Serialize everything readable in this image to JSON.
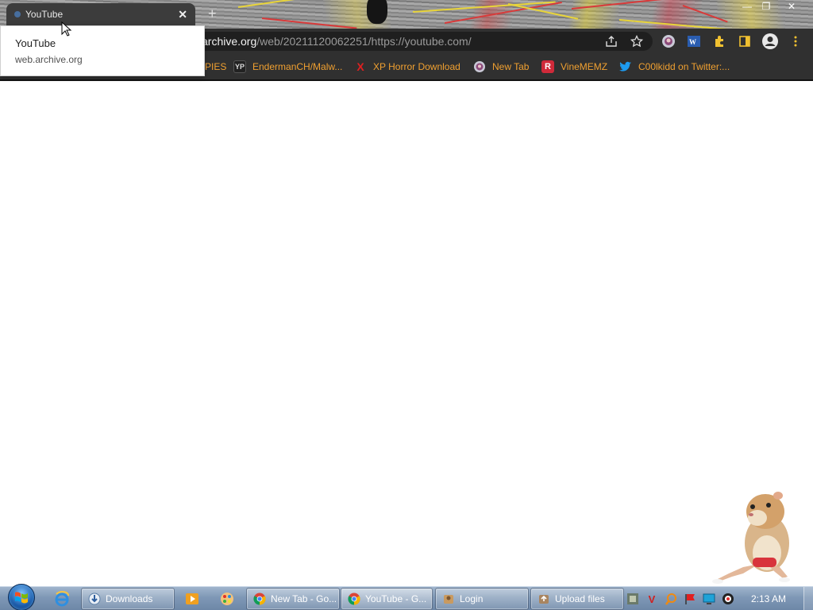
{
  "browser": {
    "tab": {
      "title": "YouTube",
      "close_glyph": "✕",
      "favicon": "web-archive-favicon"
    },
    "new_tab_glyph": "+",
    "window_controls": {
      "minimize": "—",
      "restore": "❐",
      "close": "✕"
    },
    "omnibox": {
      "url_host_visible": "archive.org",
      "url_path": "/web/20211120062251/https://youtube.com/"
    },
    "toolbar_icons": [
      "share-icon",
      "star-icon",
      "profile-extension-icon",
      "wp-extension-icon",
      "puzzle-extensions-icon",
      "side-panel-icon",
      "account-icon",
      "menu-kebab-icon"
    ],
    "bookmarks": [
      {
        "label": "PIES",
        "icon": "none"
      },
      {
        "label": "EndermanCH/Malw...",
        "icon": "yp-icon",
        "icon_text": "YP"
      },
      {
        "label": "XP Horror Download",
        "icon": "x-icon",
        "icon_text": "X"
      },
      {
        "label": "New Tab",
        "icon": "globe-icon"
      },
      {
        "label": "VineMEMZ",
        "icon": "r-icon",
        "icon_text": "R"
      },
      {
        "label": "C00lkidd on Twitter:...",
        "icon": "twitter-icon"
      }
    ],
    "hover_card": {
      "title": "YouTube",
      "domain": "web.archive.org"
    }
  },
  "colors": {
    "bookmark_text": "#f0a030",
    "toolbar_bg": "#303030",
    "omnibox_bg": "#1f1f1f",
    "taskbar": "#7f98b6"
  },
  "taskbar": {
    "pinned": [
      "internet-explorer-icon",
      "media-player-icon",
      "paint-icon"
    ],
    "buttons": [
      {
        "label": "Downloads",
        "icon": "explorer-icon",
        "active": false
      },
      {
        "label": "New Tab - Go...",
        "icon": "chrome-icon",
        "active": false
      },
      {
        "label": "YouTube - G...",
        "icon": "chrome-icon",
        "active": true
      },
      {
        "label": "Login",
        "icon": "app-icon",
        "active": false
      },
      {
        "label": "Upload files",
        "icon": "app-icon",
        "active": false
      }
    ],
    "tray_icons": [
      "tray-app-icon",
      "tray-v-icon",
      "tray-search-icon",
      "tray-flag-icon",
      "tray-monitor-icon",
      "tray-record-icon"
    ],
    "tray_v_text": "V",
    "clock": "2:13 AM"
  }
}
